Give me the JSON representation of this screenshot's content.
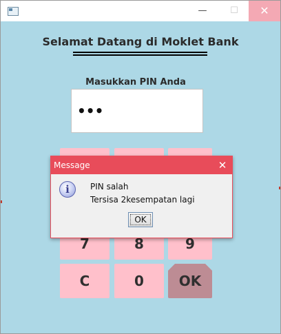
{
  "window": {
    "heading": "Selamat Datang di Moklet Bank"
  },
  "titlebar": {
    "minimize_icon": "—",
    "maximize_icon": "☐",
    "close_icon": "✕"
  },
  "pin": {
    "label": "Masukkan PIN Anda",
    "value": "•••"
  },
  "keypad": {
    "row3": [
      "7",
      "8",
      "9"
    ],
    "row4": [
      "C",
      "0",
      "OK"
    ]
  },
  "dialog": {
    "title": "Message",
    "close_icon": "✕",
    "message_line1": "PIN salah",
    "message_line2": "Tersisa 2kesempatan lagi",
    "ok_label": "OK",
    "icon": "info-icon"
  },
  "colors": {
    "background": "#add8e6",
    "key": "#ffc0cb",
    "ok_key": "#bd8c94",
    "dialog_title": "#e84c5a"
  }
}
